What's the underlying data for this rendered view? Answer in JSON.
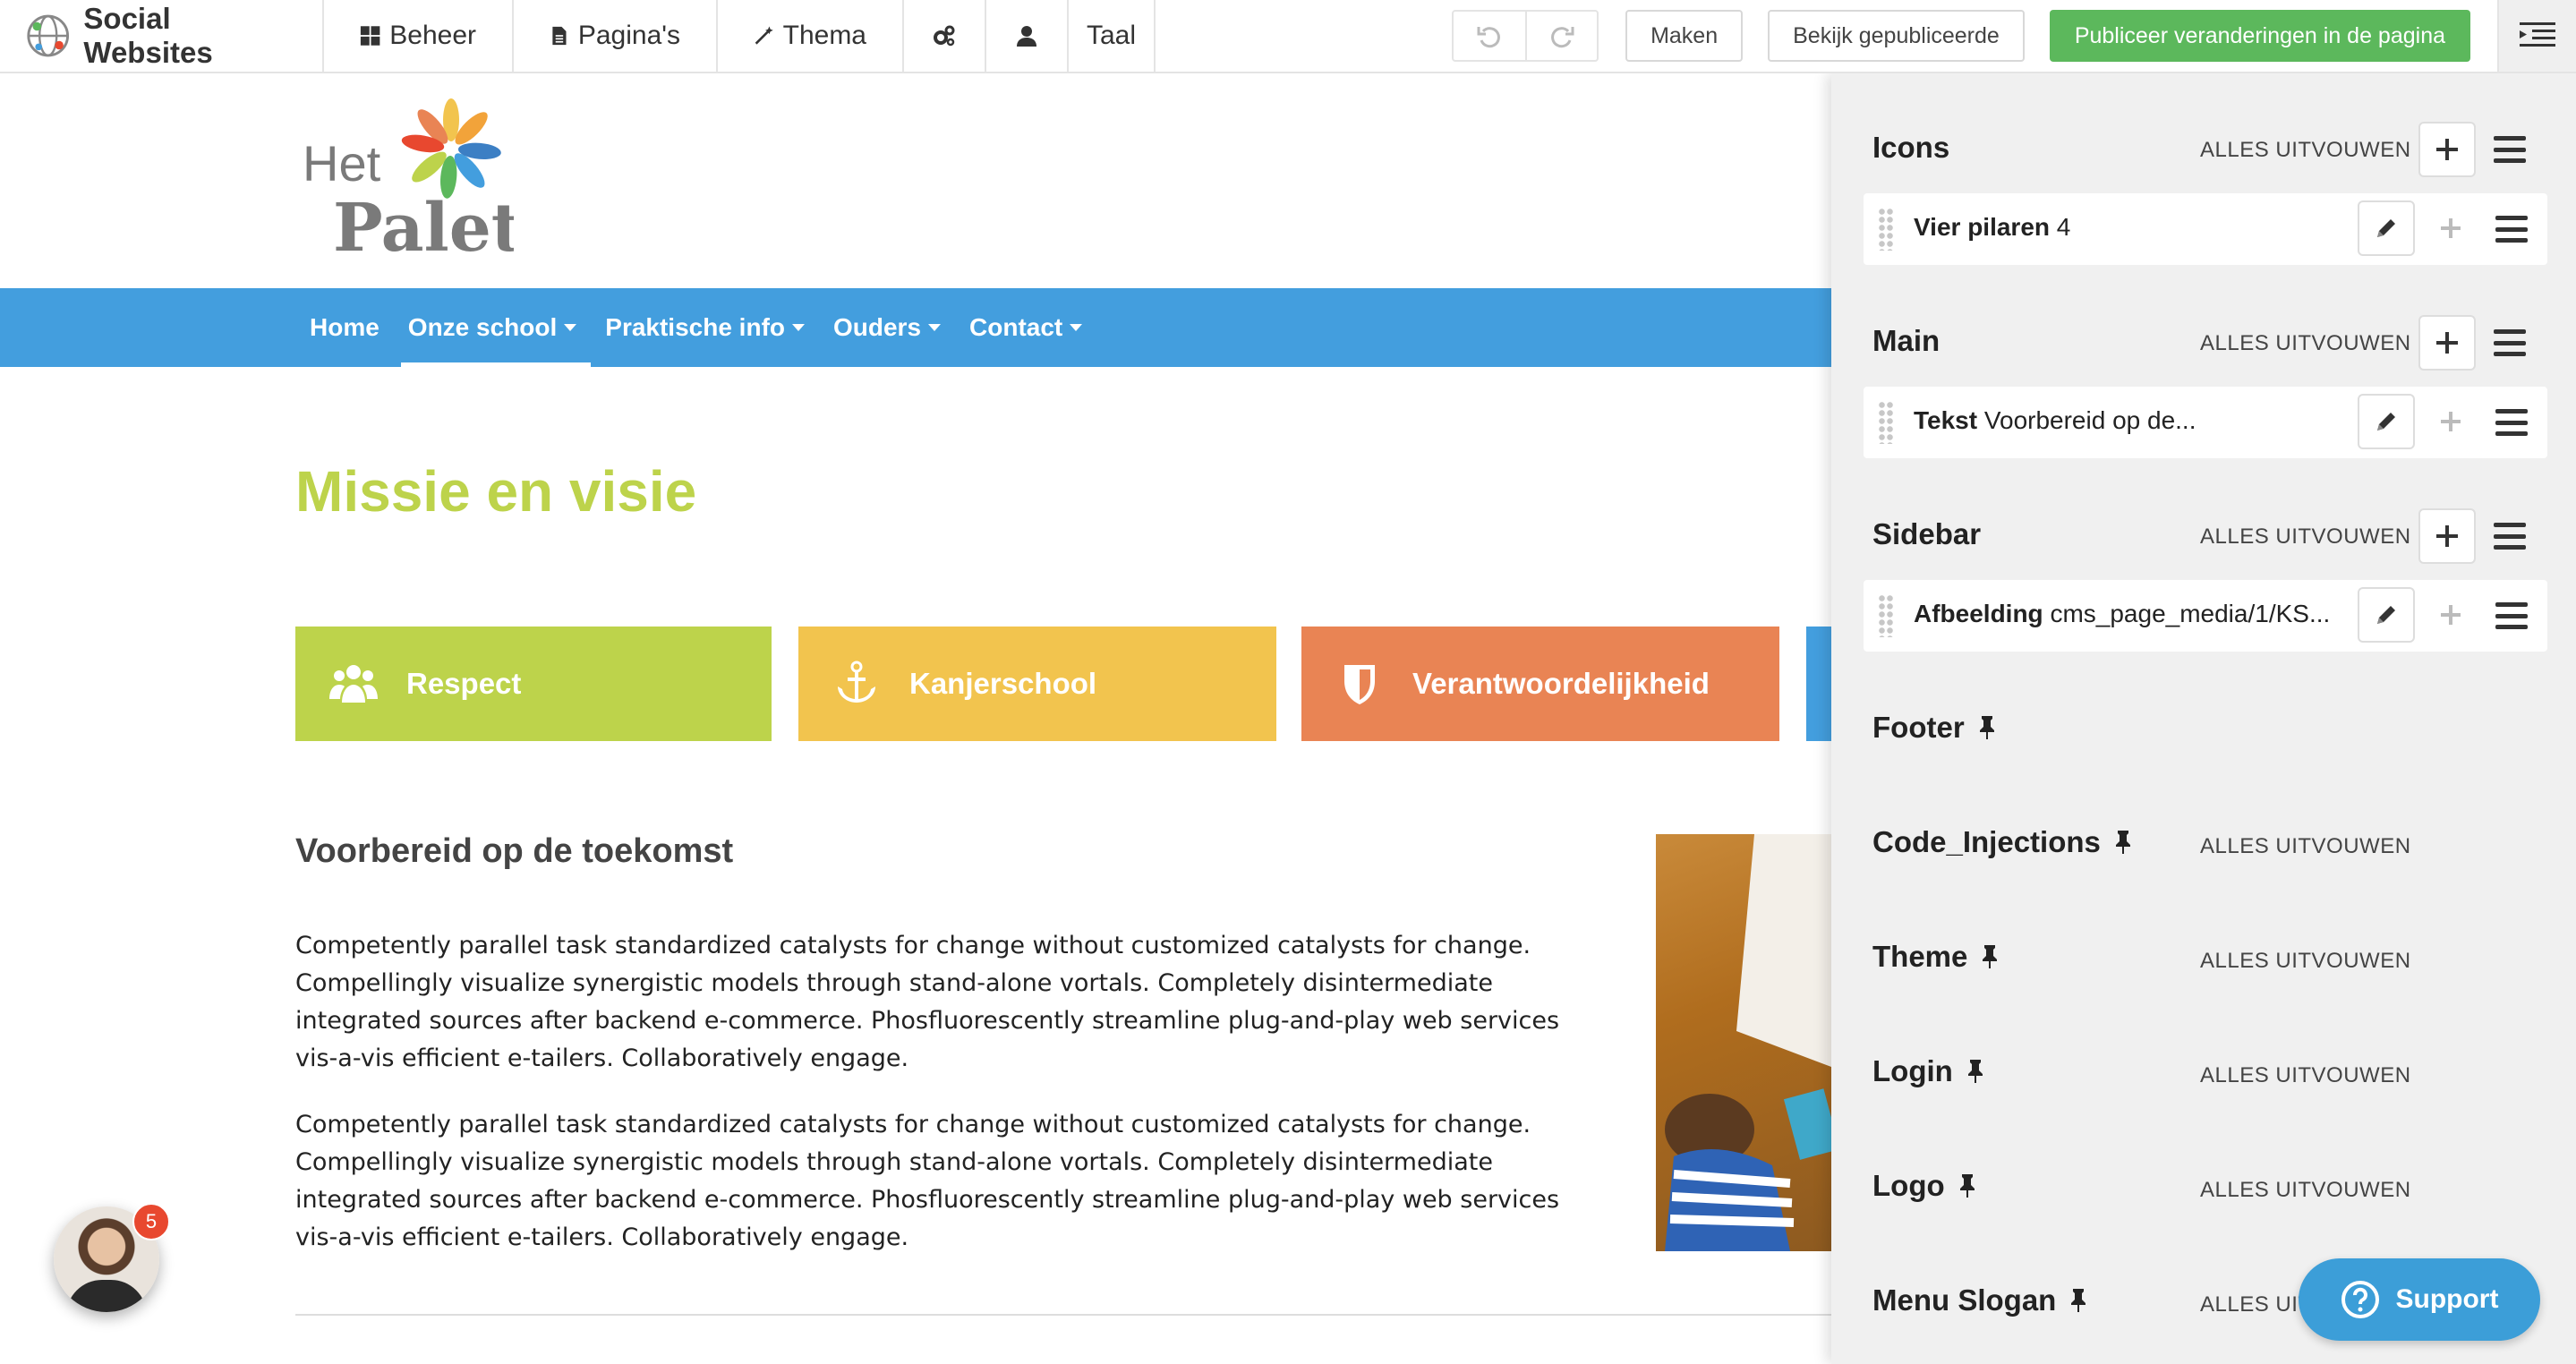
{
  "topbar": {
    "brand": "Social Websites",
    "nav": [
      {
        "label": "Beheer"
      },
      {
        "label": "Pagina's"
      },
      {
        "label": "Thema"
      },
      {
        "label": "Taal"
      }
    ],
    "maken_label": "Maken",
    "view_published_label": "Bekijk gepubliceerde",
    "publish_label": "Publiceer veranderingen in de pagina"
  },
  "site": {
    "logo_word1": "Het",
    "logo_word2": "Palet",
    "nav": [
      {
        "label": "Home"
      },
      {
        "label": "Onze school"
      },
      {
        "label": "Praktische info"
      },
      {
        "label": "Ouders"
      },
      {
        "label": "Contact"
      }
    ],
    "page_title": "Missie en visie",
    "pillars": [
      {
        "label": "Respect",
        "color": "#bdd34b"
      },
      {
        "label": "Kanjerschool",
        "color": "#f2c44e"
      },
      {
        "label": "Verantwoordelijkheid",
        "color": "#e98454"
      }
    ],
    "pillar_extra_color": "#439ede",
    "section_heading": "Voorbereid op de toekomst",
    "paragraphs": [
      "Competently parallel task standardized catalysts for change without customized catalysts for change. Compellingly visualize synergistic models through stand-alone vortals. Completely disintermediate integrated sources after backend e-commerce. Phosfluorescently streamline plug-and-play web services vis-a-vis efficient e-tailers. Collaboratively engage.",
      "Competently parallel task standardized catalysts for change without customized catalysts for change. Compellingly visualize synergistic models through stand-alone vortals. Completely disintermediate integrated sources after backend e-commerce. Phosfluorescently streamline plug-and-play web services vis-a-vis efficient e-tailers. Collaboratively engage."
    ],
    "chat_badge": "5"
  },
  "panel": {
    "expand_label": "ALLES UITVOUWEN",
    "areas": [
      {
        "title": "Icons",
        "block_type": "Vier pilaren",
        "block_value": "4"
      },
      {
        "title": "Main",
        "block_type": "Tekst",
        "block_value": "Voorbereid op de..."
      },
      {
        "title": "Sidebar",
        "block_type": "Afbeelding",
        "block_value": "cms_page_media/1/KS..."
      }
    ],
    "pinned": [
      "Footer",
      "Code_Injections",
      "Theme",
      "Login",
      "Logo",
      "Menu Slogan"
    ],
    "last_expand_partial": "ALLES UIT"
  },
  "support_label": "Support",
  "colors": {
    "publish": "#5cb85c",
    "site_nav": "#439ede",
    "title_green": "#bdd34b",
    "support": "#3c9ed8"
  },
  "icons": {
    "beheer": "grid-icon",
    "paginas": "file-icon",
    "thema": "wand-icon",
    "settings": "gears-icon",
    "user": "user-icon",
    "undo": "undo-icon",
    "redo": "redo-icon",
    "panel": "panel-menu-icon",
    "respect": "users-icon",
    "kanjerschool": "anchor-icon",
    "verantwoordelijkheid": "shield-icon",
    "pin": "pin-icon",
    "support": "question-circle-icon"
  }
}
